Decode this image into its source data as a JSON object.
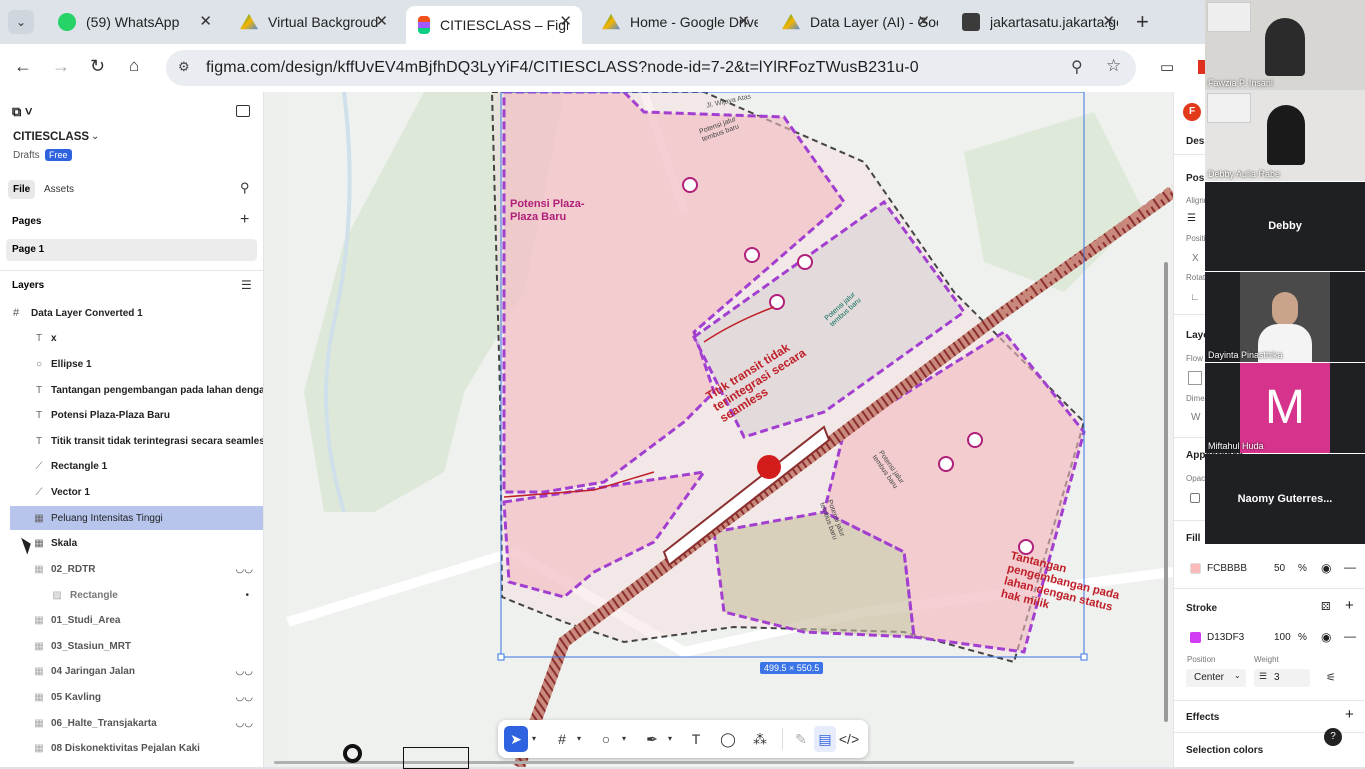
{
  "browser": {
    "tabs": [
      {
        "label": "(59) WhatsApp",
        "icon": "whatsapp-icon",
        "color": "#25d366"
      },
      {
        "label": "Virtual Backgroud",
        "icon": "google-drive-icon",
        "color": "#f4b400"
      },
      {
        "label": "CITIESCLASS – Figma",
        "icon": "figma-icon",
        "color": "#f24e1e"
      },
      {
        "label": "Home - Google Drive",
        "icon": "google-drive-icon",
        "color": "#f4b400"
      },
      {
        "label": "Data Layer (AI) - Google Drive",
        "icon": "google-drive-icon",
        "color": "#f4b400"
      },
      {
        "label": "jakartasatu.jakarta.go.id",
        "icon": "site-icon",
        "color": "#333"
      }
    ],
    "url": "figma.com/design/kffUvEV4mBjfhDQ3LyYiF4/CITIESCLASS?node-id=7-2&t=lYlRFozTWusB231u-0"
  },
  "left_panel": {
    "file_name": "CITIESCLASS",
    "drafts": "Drafts",
    "plan": "Free",
    "tab_file": "File",
    "tab_assets": "Assets",
    "pages_heading": "Pages",
    "page_1": "Page 1",
    "layers_heading": "Layers",
    "root_layer": "Data Layer Converted 1",
    "layers": [
      {
        "label": "x",
        "icon": "T"
      },
      {
        "label": "Ellipse 1",
        "icon": "○"
      },
      {
        "label": "Tantangan pengembangan pada lahan dengan status",
        "icon": "T"
      },
      {
        "label": "Potensi Plaza-Plaza Baru",
        "icon": "T"
      },
      {
        "label": "Titik transit tidak terintegrasi secara seamless",
        "icon": "T"
      },
      {
        "label": "Rectangle 1",
        "icon": "⟋"
      },
      {
        "label": "Vector 1",
        "icon": "⟋"
      },
      {
        "label": "Peluang Intensitas Tinggi",
        "icon": "▦"
      },
      {
        "label": "Skala",
        "icon": "▦"
      },
      {
        "label": "02_RDTR",
        "icon": "▦"
      },
      {
        "label": "Rectangle",
        "icon": "▨"
      },
      {
        "label": "01_Studi_Area",
        "icon": "▦"
      },
      {
        "label": "03_Stasiun_MRT",
        "icon": "▦"
      },
      {
        "label": "04 Jaringan Jalan",
        "icon": "▦"
      },
      {
        "label": "05 Kavling",
        "icon": "▦"
      },
      {
        "label": "06_Halte_Transjakarta",
        "icon": "▦"
      },
      {
        "label": "08 Diskonektivitas Pejalan Kaki",
        "icon": "▦"
      }
    ]
  },
  "canvas": {
    "map_labels": {
      "plaza": "Potensi Plaza-\nPlaza Baru",
      "titik": "Titik transit tidak\nterintegrasi secara\nseamless",
      "tantangan": "Tantangan\npengembangan pada\nlahan dengan status\nhak milik",
      "jalur1": "Potensi jalur\ntembus baru",
      "jalur2": "Potensi jalur\ntembus baru",
      "jalur3": "Potensi jalur\ntembus baru",
      "jalur4": "Potensi jalur\ntembus baru",
      "street": "Jl. Wijaya Atas"
    },
    "dimension_label": "499.5 × 550.5"
  },
  "right_panel": {
    "avatar_letter": "F",
    "design_tab": "Design",
    "position_heading": "Position",
    "alignment": "Alignment",
    "position": "Position",
    "x_label": "X",
    "rotation": "Rotation",
    "layout_heading": "Layout",
    "flow": "Flow",
    "dimensions": "Dimensions",
    "w_label": "W",
    "appearance_heading": "Appearance",
    "opacity": "Opacity",
    "fill_heading": "Fill",
    "fill_hex": "FCBBBB",
    "fill_opacity": "50",
    "fill_color": "#FCBBBB",
    "stroke_heading": "Stroke",
    "stroke_hex": "D13DF3",
    "stroke_opacity": "100",
    "stroke_color": "#D13DF3",
    "percent": "%",
    "position_label": "Position",
    "weight_label": "Weight",
    "stroke_position": "Center",
    "stroke_weight": "3",
    "effects_heading": "Effects",
    "selection_colors": "Selection colors"
  },
  "meeting": {
    "participants": [
      {
        "name": "Fawzia P. Insani"
      },
      {
        "name": "Debby Aulia Rabe"
      },
      {
        "name": "Debby"
      },
      {
        "name": "Dayinta Pinasthika"
      },
      {
        "name": "Miftahul Huda",
        "initial": "M",
        "color": "#d6338c"
      },
      {
        "name": "Naomy Guterres..."
      }
    ]
  },
  "toolbar": {
    "tools": [
      "move-tool",
      "frame-tool",
      "shape-tool",
      "pen-tool",
      "text-tool",
      "comment-tool",
      "actions-tool",
      "draw-mode",
      "design-mode",
      "dev-mode"
    ]
  }
}
